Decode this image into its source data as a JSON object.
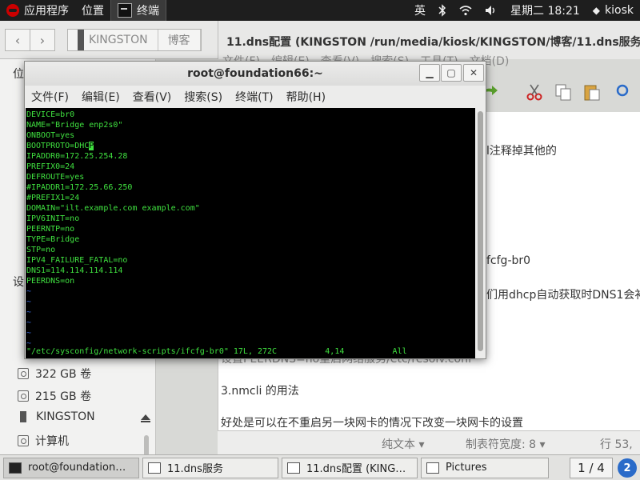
{
  "topbar": {
    "applications": "应用程序",
    "places": "位置",
    "active_task": "终端",
    "input_method": "英",
    "clock": "星期二 18:21",
    "user": "kiosk"
  },
  "file_manager": {
    "path": [
      "KINGSTON",
      "博客"
    ],
    "sidebar": {
      "heading1": "位",
      "heading2": "设",
      "drives": [
        {
          "label": "322 GB 卷"
        },
        {
          "label": "215 GB 卷"
        },
        {
          "label": "KINGSTON"
        },
        {
          "label": "计算机"
        }
      ]
    }
  },
  "editor": {
    "title": "11.dns配置 (KINGSTON /run/media/kiosk/KINGSTON/博客/11.dns服务)",
    "menu": [
      "文件(F)",
      "编辑(E)",
      "查看(V)",
      "搜索(S)",
      "工具(T)",
      "文档(D)"
    ],
    "visible_text": [
      "l注释掉其他的",
      "fcfg-br0",
      "们用dhcp自动获取时DNS1会补",
      "设置PEERDNS=no重启网络服务/etc/resolv.conf",
      "3.nmcli 的用法",
      "好处是可以在不重启另一块网卡的情况下改变一块网卡的设置"
    ],
    "status": {
      "mode": "纯文本 ▾",
      "tab_width": "制表符宽度: 8 ▾",
      "position": "行 53,"
    }
  },
  "terminal": {
    "title": "root@foundation66:~",
    "menu": [
      "文件(F)",
      "编辑(E)",
      "查看(V)",
      "搜索(S)",
      "终端(T)",
      "帮助(H)"
    ],
    "lines": [
      "DEVICE=br0",
      "NAME=\"Bridge enp2s0\"",
      "ONBOOT=yes",
      "BOOTPROTO=DHC",
      "IPADDR0=172.25.254.28",
      "PREFIX0=24",
      "DEFROUTE=yes",
      "#IPADDR1=172.25.66.250",
      "#PREFIX1=24",
      "DOMAIN=\"ilt.example.com example.com\"",
      "IPV6INIT=no",
      "PEERNTP=no",
      "TYPE=Bridge",
      "STP=no",
      "IPV4_FAILURE_FATAL=no",
      "DNS1=114.114.114.114",
      "PEERDNS=on"
    ],
    "cursor_char": "P",
    "tildes": [
      "~",
      "~",
      "~",
      "~",
      "~",
      "~",
      "~"
    ],
    "status_line": "\"/etc/sysconfig/network-scripts/ifcfg-br0\" 17L, 272C          4,14          All"
  },
  "taskbar": {
    "tasks": [
      {
        "label": "root@foundation…"
      },
      {
        "label": "11.dns服务"
      },
      {
        "label": "11.dns配置 (KING…"
      },
      {
        "label": "Pictures"
      }
    ],
    "workspace": "1 / 4",
    "notification_badge": "2"
  }
}
